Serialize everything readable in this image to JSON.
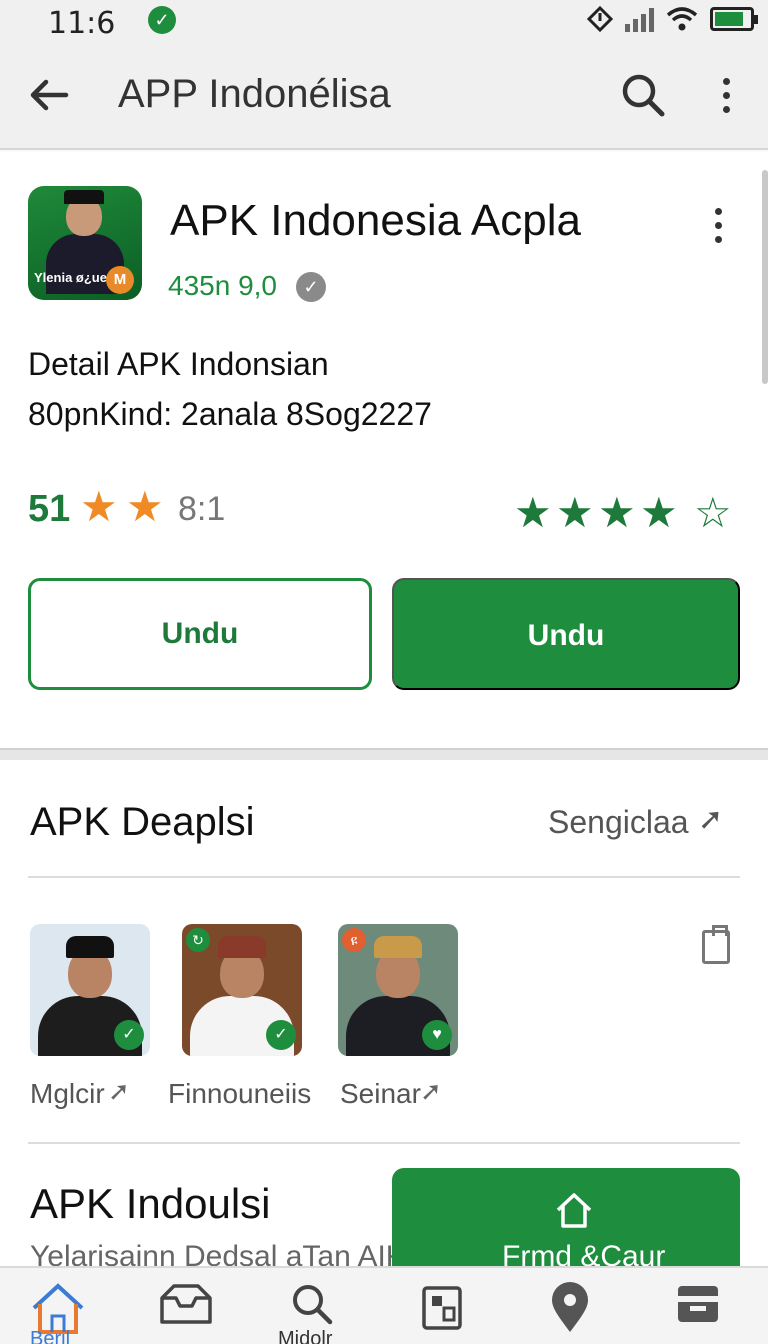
{
  "status_bar": {
    "time": "11:6"
  },
  "app_bar": {
    "title": "APP Indonélisa"
  },
  "app_card": {
    "icon_text": "Ylenia ø¿ue",
    "icon_badge": "M",
    "name": "APK Indonesia Acpla",
    "version": "435n 9,0",
    "detail_line1": "Detail  APK Indonsian",
    "detail_line2": "80pnKind: 2anala 8Sog2227",
    "rating_value": "51",
    "rating_count": "8:1",
    "stars_orange": 2,
    "stars_green_filled": 4,
    "stars_green_total": 5,
    "btn_outline": "Undu",
    "btn_solid": "Undu"
  },
  "section": {
    "title": "APK Deaplsi",
    "link": "Sengiclaa",
    "items": [
      {
        "label": "Mglcir"
      },
      {
        "label": "Finnouneiis"
      },
      {
        "label": "Seinar"
      }
    ]
  },
  "section2": {
    "title": "APK Indoulsi",
    "subtitle": "Yelarisainn Dedsal aTan AIK Se",
    "find_label": "Frmd &Caur"
  },
  "bottom_nav": {
    "label_home": "Beril",
    "label_search": "Midolr"
  },
  "colors": {
    "accent": "#1e8e3e",
    "star_orange": "#f08a24",
    "text": "#111111"
  }
}
